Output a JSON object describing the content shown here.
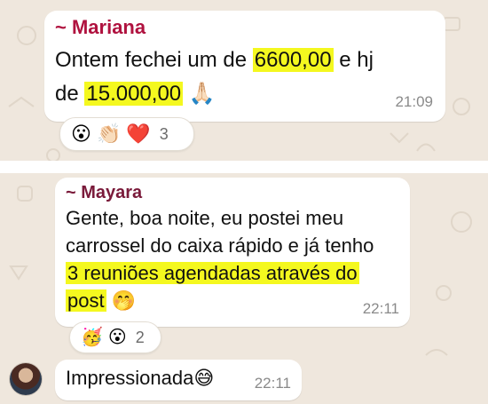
{
  "messages": [
    {
      "sender": "~ Mariana",
      "sender_color": "#b0123f",
      "lines": [
        {
          "text_a": "Ontem fechei um de ",
          "highlight": "6600,00",
          "text_b": " e hj"
        },
        {
          "text_a": "de ",
          "highlight": "15.000,00",
          "emoji": "🙏🏻"
        }
      ],
      "time": "21:09",
      "reactions": [
        "😮",
        "👏🏻",
        "❤️"
      ],
      "reaction_count": "3"
    },
    {
      "sender": "~ Mayara",
      "sender_color": "#7a1a3a",
      "lines": [
        "Gente, boa noite, eu postei meu",
        "carrossel do caixa rápido e já tenho",
        "3 reuniões agendadas através do",
        "post"
      ],
      "last_emoji": "🤭",
      "highlight_color": "#f4f81f",
      "time": "22:11",
      "reactions": [
        "🥳",
        "😮"
      ],
      "reaction_count": "2"
    },
    {
      "text": "Impressionada",
      "emoji": "😅",
      "time": "22:11"
    }
  ],
  "icons": [
    "avatar"
  ]
}
